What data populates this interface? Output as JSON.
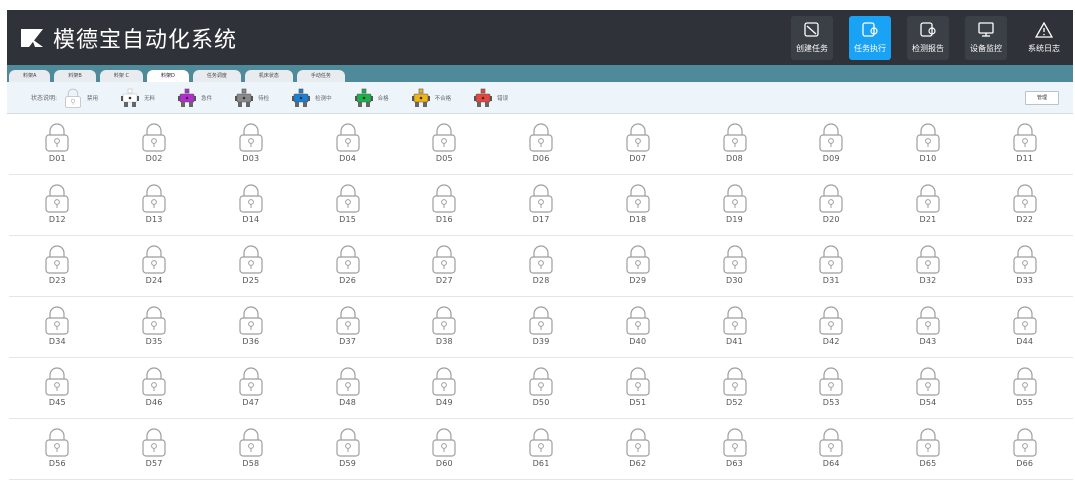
{
  "app": {
    "title": "模德宝自动化系统"
  },
  "nav": [
    {
      "label": "创建任务",
      "icon": "create-task-icon",
      "state": "default"
    },
    {
      "label": "任务执行",
      "icon": "task-execute-icon",
      "state": "active"
    },
    {
      "label": "检测报告",
      "icon": "inspection-report-icon",
      "state": "default"
    },
    {
      "label": "设备监控",
      "icon": "monitor-icon",
      "state": "default"
    },
    {
      "label": "系统日志",
      "icon": "warning-icon",
      "state": "default"
    }
  ],
  "tabs": [
    {
      "label": "料架A",
      "active": false
    },
    {
      "label": "料架B",
      "active": false
    },
    {
      "label": "料架 C",
      "active": false
    },
    {
      "label": "料架D",
      "active": true
    },
    {
      "label": "任务调度",
      "active": false
    },
    {
      "label": "机床状态",
      "active": false
    },
    {
      "label": "手动任务",
      "active": false
    }
  ],
  "legend": {
    "title": "状态说明:",
    "items": [
      {
        "label": "禁用",
        "kind": "lock",
        "color": "#bfbfbf"
      },
      {
        "label": "无料",
        "kind": "outline",
        "color": "#bfbfbf"
      },
      {
        "label": "急件",
        "kind": "robot",
        "color": "#b42bd0"
      },
      {
        "label": "待检",
        "kind": "robot",
        "color": "#8a8a8a"
      },
      {
        "label": "检测中",
        "kind": "robot",
        "color": "#1a7fd6"
      },
      {
        "label": "合格",
        "kind": "robot",
        "color": "#19b34a"
      },
      {
        "label": "不合格",
        "kind": "robot",
        "color": "#f0b418"
      },
      {
        "label": "错误",
        "kind": "robot",
        "color": "#e8463c"
      }
    ],
    "manage_label": "管理"
  },
  "slots": [
    [
      "D01",
      "D02",
      "D03",
      "D04",
      "D05",
      "D06",
      "D07",
      "D08",
      "D09",
      "D10",
      "D11"
    ],
    [
      "D12",
      "D13",
      "D14",
      "D15",
      "D16",
      "D17",
      "D18",
      "D19",
      "D20",
      "D21",
      "D22"
    ],
    [
      "D23",
      "D24",
      "D25",
      "D26",
      "D27",
      "D28",
      "D29",
      "D30",
      "D31",
      "D32",
      "D33"
    ],
    [
      "D34",
      "D35",
      "D36",
      "D37",
      "D38",
      "D39",
      "D40",
      "D41",
      "D42",
      "D43",
      "D44"
    ],
    [
      "D45",
      "D46",
      "D47",
      "D48",
      "D49",
      "D50",
      "D51",
      "D52",
      "D53",
      "D54",
      "D55"
    ],
    [
      "D56",
      "D57",
      "D58",
      "D59",
      "D60",
      "D61",
      "D62",
      "D63",
      "D64",
      "D65",
      "D66"
    ]
  ],
  "colors": {
    "header_bg": "#2f3238",
    "accent": "#1aa3f5",
    "tabbar_bg": "#4e8a9a",
    "legend_bg": "#edf4fa"
  }
}
